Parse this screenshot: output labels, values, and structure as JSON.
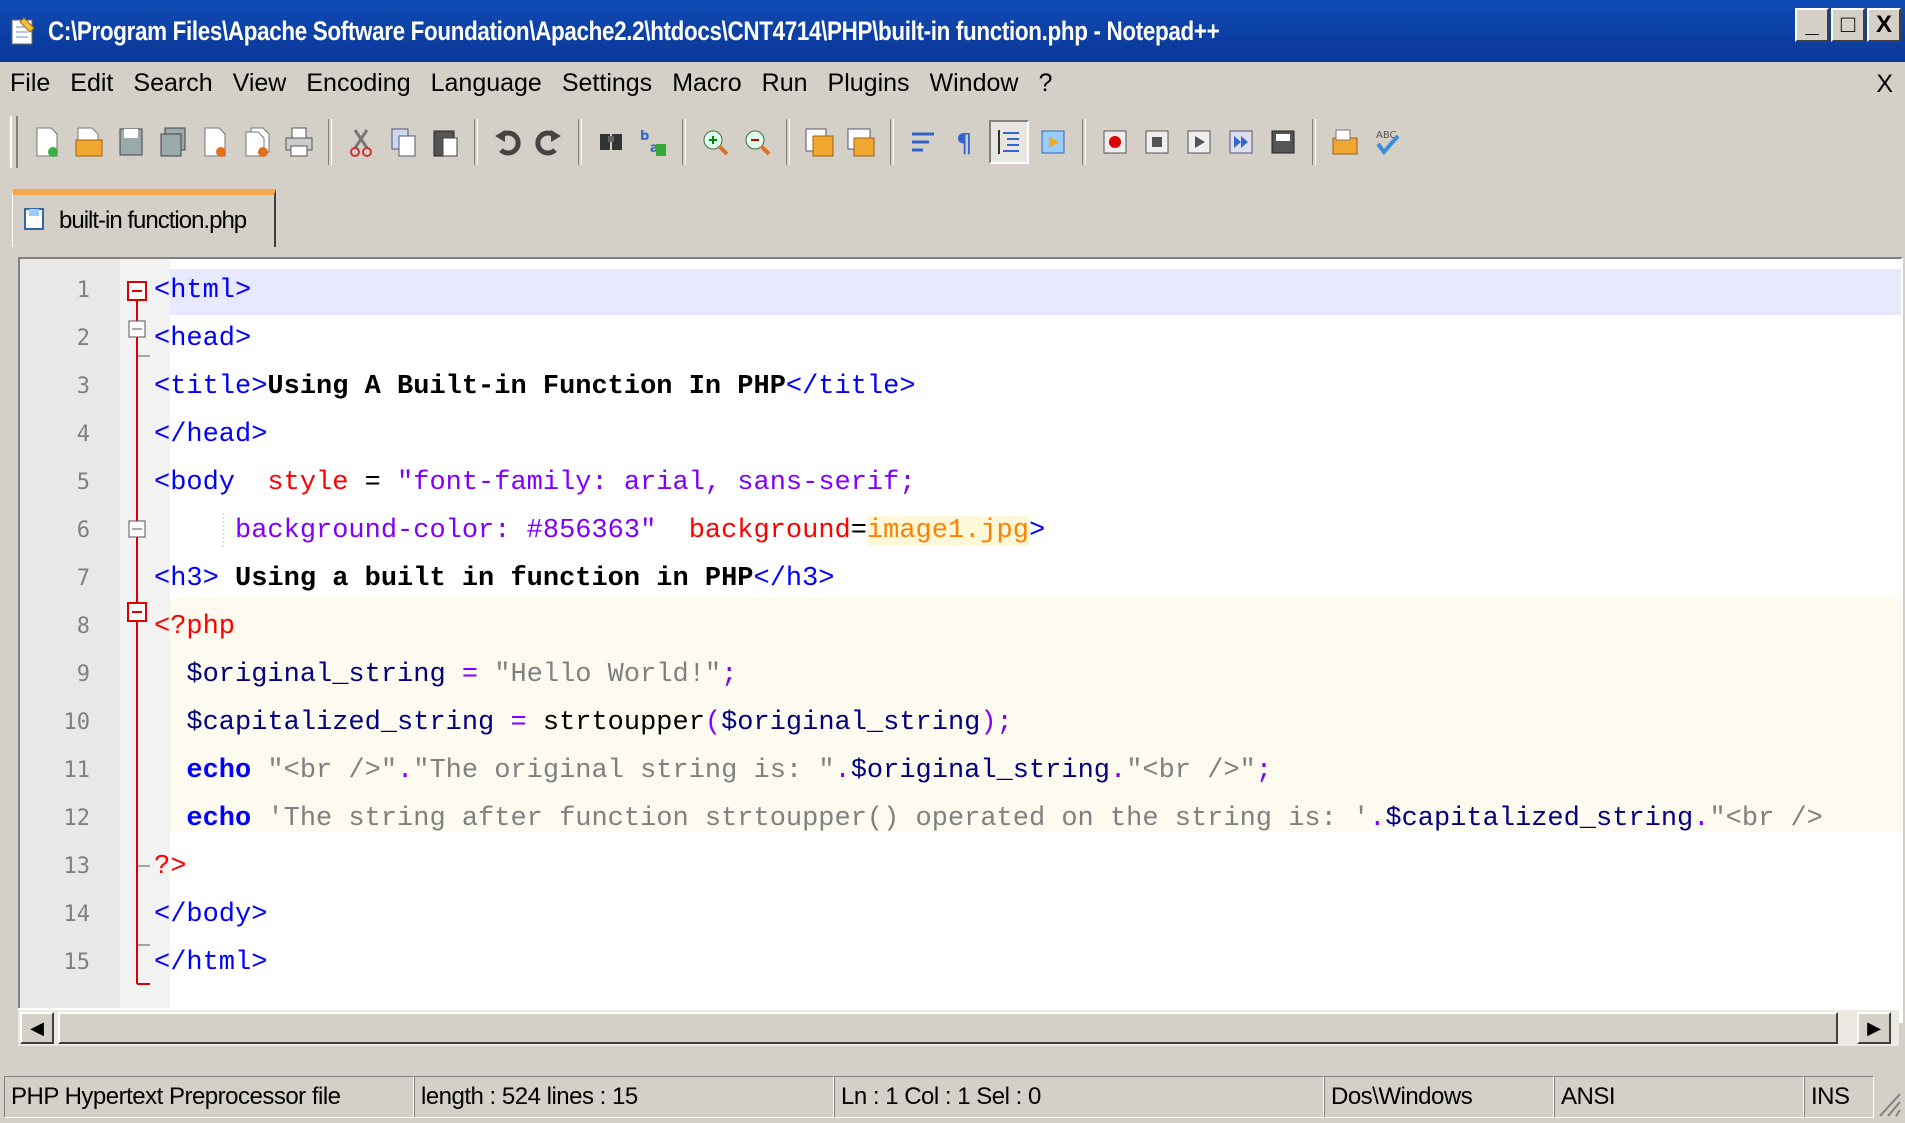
{
  "window": {
    "title": "C:\\Program Files\\Apache Software Foundation\\Apache2.2\\htdocs\\CNT4714\\PHP\\built-in function.php - Notepad++",
    "minimize": "_",
    "maximize": "□",
    "close": "X"
  },
  "menu": {
    "items": [
      "File",
      "Edit",
      "Search",
      "View",
      "Encoding",
      "Language",
      "Settings",
      "Macro",
      "Run",
      "Plugins",
      "Window",
      "?"
    ],
    "close": "X"
  },
  "toolbar": {
    "icons": [
      "new-file-icon",
      "open-file-icon",
      "save-icon",
      "save-all-icon",
      "close-icon",
      "close-all-icon",
      "print-icon",
      "cut-icon",
      "copy-icon",
      "paste-icon",
      "undo-icon",
      "redo-icon",
      "find-icon",
      "replace-icon",
      "zoom-in-icon",
      "zoom-out-icon",
      "sync-vertical-icon",
      "sync-horizontal-icon",
      "word-wrap-icon",
      "show-all-chars-icon",
      "indent-guide-icon",
      "user-defined-language-icon",
      "record-macro-icon",
      "stop-record-icon",
      "playback-macro-icon",
      "run-macro-multiple-icon",
      "save-macro-icon",
      "trim-icon",
      "spell-check-icon"
    ]
  },
  "tab": {
    "label": "built-in function.php"
  },
  "editor": {
    "lines": [
      {
        "n": "1"
      },
      {
        "n": "2"
      },
      {
        "n": "3"
      },
      {
        "n": "4"
      },
      {
        "n": "5"
      },
      {
        "n": "6"
      },
      {
        "n": "7"
      },
      {
        "n": "8"
      },
      {
        "n": "9"
      },
      {
        "n": "10"
      },
      {
        "n": "11"
      },
      {
        "n": "12"
      },
      {
        "n": "13"
      },
      {
        "n": "14"
      },
      {
        "n": "15"
      }
    ],
    "code": {
      "l1": "<html>",
      "l2": "<head>",
      "l3_open": "<title>",
      "l3_text": "Using A Built-in Function In PHP",
      "l3_close": "</title>",
      "l4": "</head>",
      "l5_tag": "<body",
      "l5_attr": "style",
      "l5_eq": " = ",
      "l5_val": "\"font-family: arial, sans-serif;",
      "l6_val": "background-color: #856363\"",
      "l6_attr": "background",
      "l6_eq": "=",
      "l6_img": "image1.jpg",
      "l6_close": ">",
      "l7_open": "<h3>",
      "l7_text": " Using a built in function in PHP",
      "l7_close": "</h3>",
      "l8": "<?php",
      "l9_var": "$original_string",
      "l9_op": " = ",
      "l9_str": "\"Hello World!\"",
      "l9_end": ";",
      "l10_var": "$capitalized_string",
      "l10_op": " = ",
      "l10_fn": "strtoupper",
      "l10_p1": "(",
      "l10_arg": "$original_string",
      "l10_p2": ");",
      "l11_kw": "echo",
      "l11_s1": "\"<br />\"",
      "l11_dot1": ".",
      "l11_s2": "\"The original string is: \"",
      "l11_dot2": ".",
      "l11_var": "$original_string",
      "l11_dot3": ".",
      "l11_s3": "\"<br />\"",
      "l11_end": ";",
      "l12_kw": "echo",
      "l12_s1": "'The string after function strtoupper() operated on the string is: '",
      "l12_dot1": ".",
      "l12_var": "$capitalized_string",
      "l12_dot2": ".",
      "l12_s2": "\"<br />",
      "l13": "?>",
      "l14": "</body>",
      "l15": "</html>"
    }
  },
  "statusbar": {
    "filetype": "PHP Hypertext Preprocessor file",
    "length": "length : 524    lines : 15",
    "position": "Ln : 1    Col : 1    Sel : 0",
    "eol": "Dos\\Windows",
    "encoding": "ANSI",
    "mode": "INS"
  }
}
